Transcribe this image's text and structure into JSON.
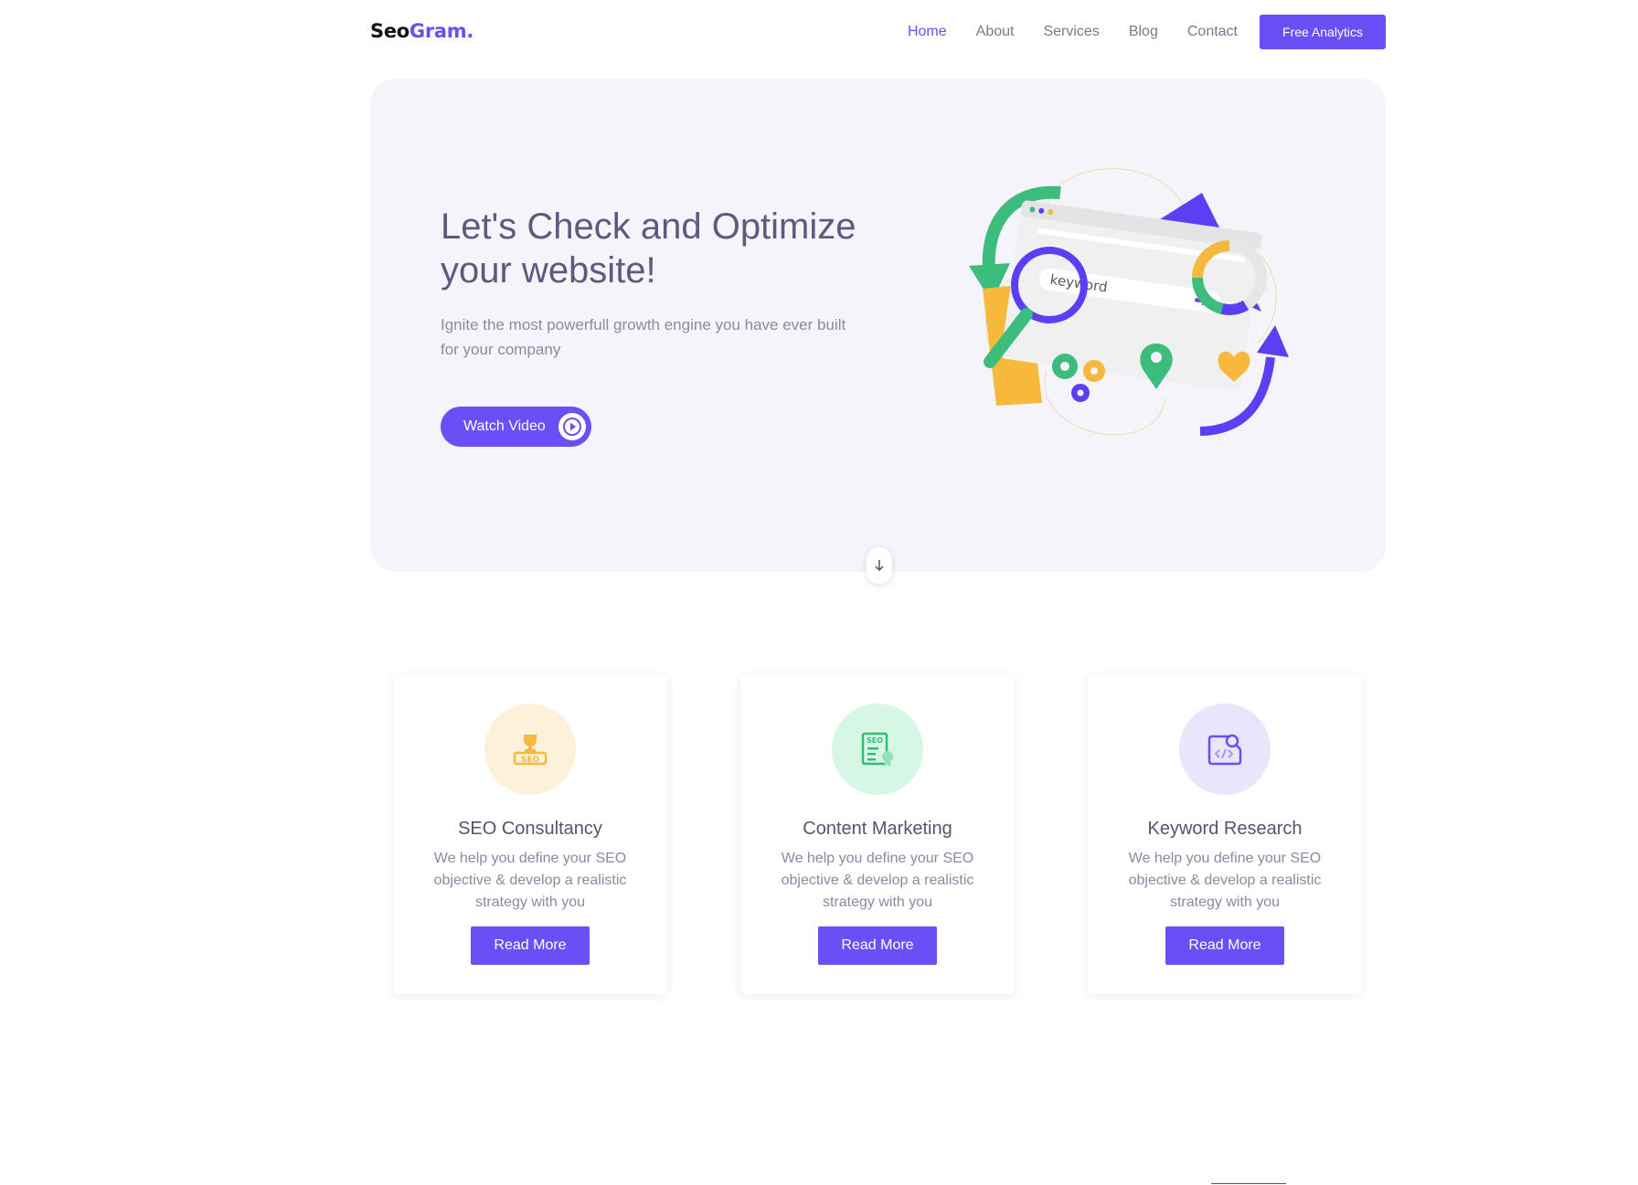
{
  "brand": {
    "logo_part1": "Seo",
    "logo_part2": "Gram."
  },
  "nav": {
    "items": [
      {
        "label": "Home",
        "active": true
      },
      {
        "label": "About"
      },
      {
        "label": "Services"
      },
      {
        "label": "Blog"
      },
      {
        "label": "Contact"
      }
    ],
    "cta_label": "Free Analytics"
  },
  "hero": {
    "title": "Let's Check and Optimize your website!",
    "subtitle": "Ignite the most powerfull growth engine you have ever built for your company",
    "watch_label": "Watch Video",
    "illustration_keyword": "keyword"
  },
  "services": [
    {
      "title": "SEO Consultancy",
      "description": "We help you define your SEO objective & develop a realistic strategy with you",
      "button": "Read More",
      "icon": "seo-trophy-icon",
      "icon_bg": "#fdf1dc",
      "icon_color": "#f6b93b"
    },
    {
      "title": "Content Marketing",
      "description": "We help you define your SEO objective & develop a realistic strategy with you",
      "button": "Read More",
      "icon": "seo-document-icon",
      "icon_bg": "#d6f7e6",
      "icon_color": "#2fbf71"
    },
    {
      "title": "Keyword Research",
      "description": "We help you define your SEO objective & develop a realistic strategy with you",
      "button": "Read More",
      "icon": "code-search-icon",
      "icon_bg": "#e9e5fb",
      "icon_color": "#6a4ff6"
    }
  ],
  "colors": {
    "accent": "#6a4ff6",
    "green": "#3dbd7d",
    "yellow": "#f6b93b",
    "hero_bg": "#f5f4fa"
  }
}
